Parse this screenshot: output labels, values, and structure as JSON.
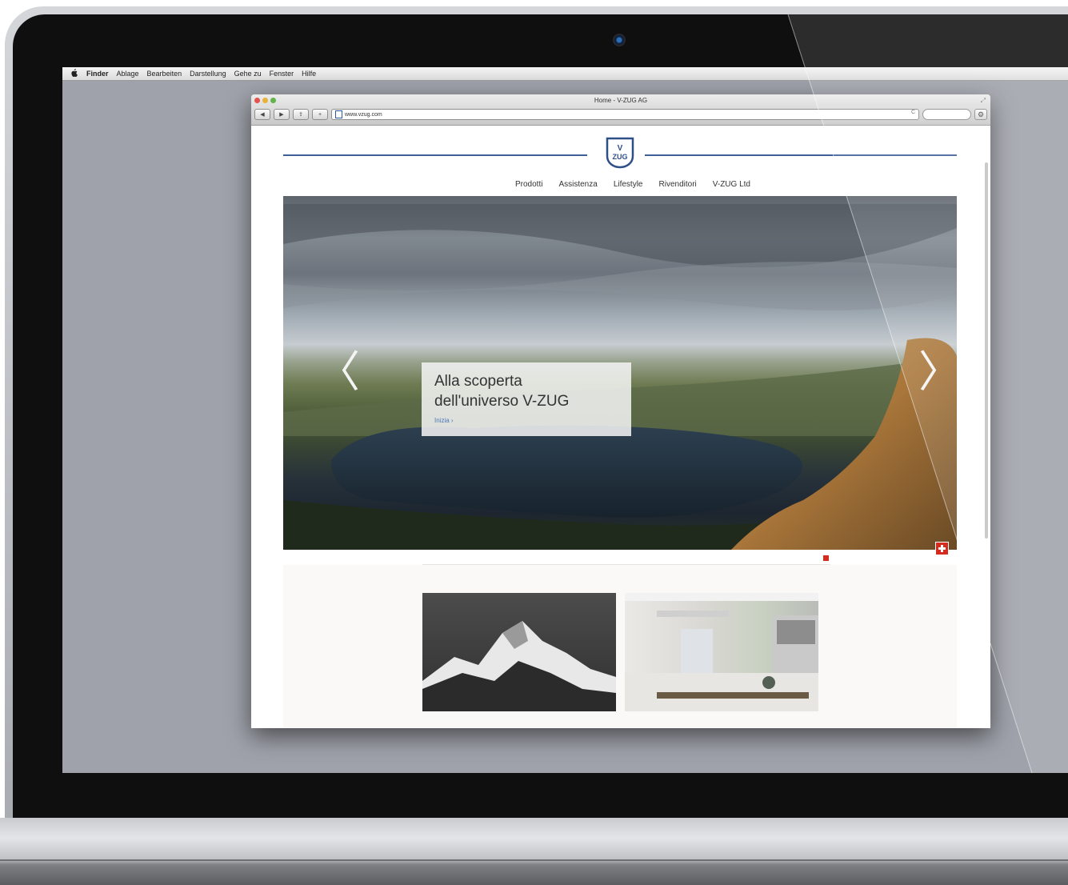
{
  "menubar": {
    "apple": "",
    "items": [
      "Finder",
      "Ablage",
      "Bearbeiten",
      "Darstellung",
      "Gehe zu",
      "Fenster",
      "Hilfe"
    ]
  },
  "browser": {
    "window_title": "Home - V-ZUG AG",
    "url": "www.vzug.com",
    "back": "◀",
    "forward": "▶",
    "share": "⇪",
    "add": "+",
    "reload": "C",
    "search_placeholder": "",
    "gear": "⚙"
  },
  "site": {
    "logo_top": "V",
    "logo_bottom": "ZUG",
    "nav": [
      "Prodotti",
      "Assistenza",
      "Lifestyle",
      "Rivenditori",
      "V-ZUG Ltd"
    ]
  },
  "hero": {
    "title_line1": "Alla scoperta",
    "title_line2": "dell'universo V-ZUG",
    "link": "Inizia ›",
    "prev": "〈",
    "next": "〉"
  },
  "sharebar": {
    "search": "",
    "items": [
      "",
      "",
      "",
      ""
    ],
    "language": ""
  },
  "colors": {
    "accent": "#3f5f9a",
    "link": "#4b79b7",
    "swiss_red": "#d52b1e"
  },
  "icons": [
    "apple-icon",
    "camera-icon",
    "swiss-flag-icon",
    "gear-icon",
    "chevron-left-icon",
    "chevron-right-icon"
  ]
}
